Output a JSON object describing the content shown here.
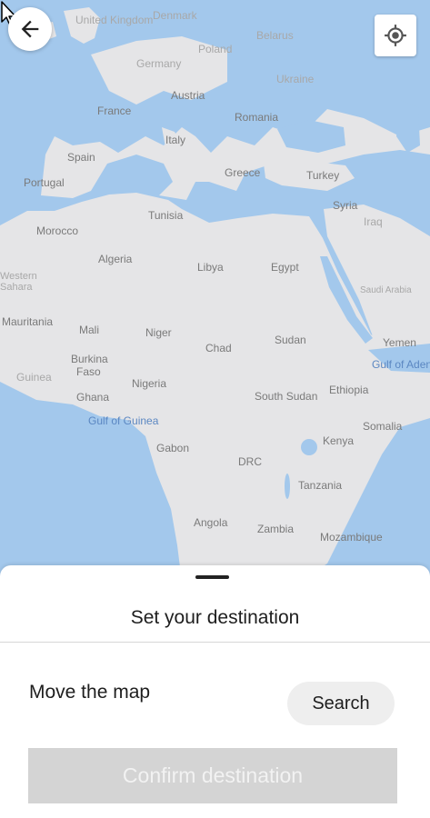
{
  "map": {
    "labels": {
      "united_kingdom": "United Kingdom",
      "denmark": "Denmark",
      "poland": "Poland",
      "belarus": "Belarus",
      "germany": "Germany",
      "ukraine": "Ukraine",
      "france": "France",
      "austria": "Austria",
      "romania": "Romania",
      "italy": "Italy",
      "spain": "Spain",
      "portugal": "Portugal",
      "greece": "Greece",
      "turkey": "Turkey",
      "tunisia": "Tunisia",
      "syria": "Syria",
      "iraq": "Iraq",
      "morocco": "Morocco",
      "algeria": "Algeria",
      "libya": "Libya",
      "egypt": "Egypt",
      "saudi_arabia": "Saudi Arabia",
      "western_sahara": "Western Sahara",
      "mauritania": "Mauritania",
      "mali": "Mali",
      "niger": "Niger",
      "chad": "Chad",
      "sudan": "Sudan",
      "yemen": "Yemen",
      "gulf_of_aden": "Gulf of Aden",
      "guinea": "Guinea",
      "burkina_faso_1": "Burkina",
      "burkina_faso_2": "Faso",
      "nigeria": "Nigeria",
      "ghana": "Ghana",
      "south_sudan": "South Sudan",
      "ethiopia": "Ethiopia",
      "gulf_of_guinea": "Gulf of Guinea",
      "somalia": "Somalia",
      "gabon": "Gabon",
      "kenya": "Kenya",
      "drc": "DRC",
      "tanzania": "Tanzania",
      "angola": "Angola",
      "zambia": "Zambia",
      "mozambique": "Mozambique"
    },
    "colors": {
      "land": "#e5e5e7",
      "water": "#a3c8ec"
    }
  },
  "header": {
    "back_icon": "arrow-left-icon",
    "locate_icon": "my-location-icon"
  },
  "sheet": {
    "title": "Set your destination",
    "hint": "Move the map",
    "search_label": "Search",
    "confirm_label": "Confirm destination"
  }
}
